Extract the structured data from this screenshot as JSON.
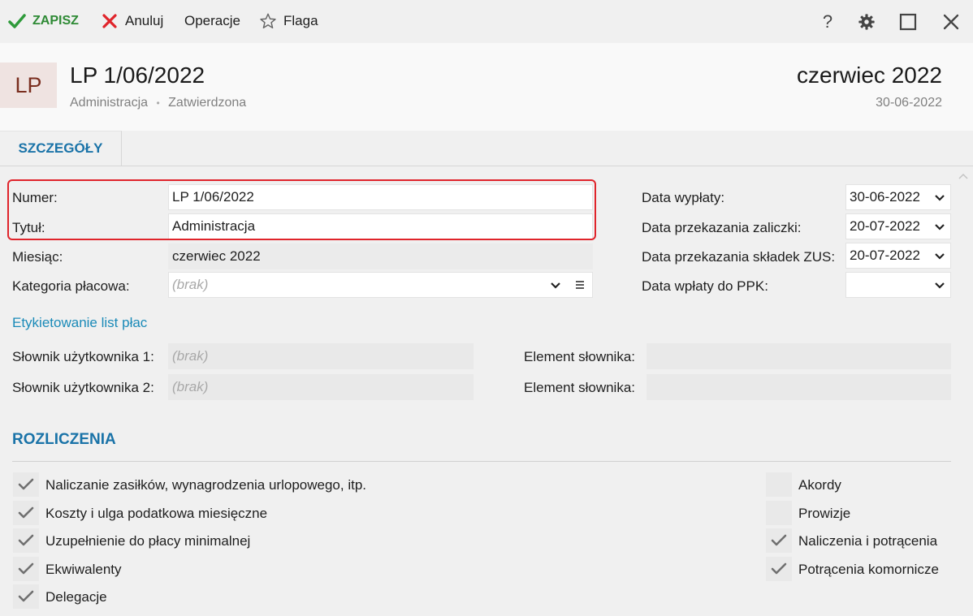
{
  "toolbar": {
    "save_label": "ZAPISZ",
    "cancel_label": "Anuluj",
    "operations_label": "Operacje",
    "flag_label": "Flaga",
    "help_label": "?"
  },
  "header": {
    "avatar_text": "LP",
    "title": "LP 1/06/2022",
    "category": "Administracja",
    "separator": "•",
    "status": "Zatwierdzona",
    "period": "czerwiec 2022",
    "date": "30-06-2022"
  },
  "tabs": [
    {
      "label": "SZCZEGÓŁY",
      "active": true
    }
  ],
  "form": {
    "numer_label": "Numer:",
    "numer_value": "LP 1/06/2022",
    "tytul_label": "Tytuł:",
    "tytul_value": "Administracja",
    "miesiac_label": "Miesiąc:",
    "miesiac_value": "czerwiec 2022",
    "kategoria_label": "Kategoria płacowa:",
    "kategoria_value": "(brak)",
    "data_wyplaty_label": "Data wypłaty:",
    "data_wyplaty_value": "30-06-2022",
    "data_zaliczki_label": "Data przekazania zaliczki:",
    "data_zaliczki_value": "20-07-2022",
    "data_zus_label": "Data przekazania składek ZUS:",
    "data_zus_value": "20-07-2022",
    "data_ppk_label": "Data wpłaty do PPK:",
    "data_ppk_value": ""
  },
  "labels": {
    "link": "Etykietowanie list płac",
    "slownik1_label": "Słownik użytkownika 1:",
    "slownik1_value": "(brak)",
    "slownik2_label": "Słownik użytkownika 2:",
    "slownik2_value": "(brak)",
    "element1_label": "Element słownika:",
    "element2_label": "Element słownika:"
  },
  "rozliczenia": {
    "title": "ROZLICZENIA",
    "left": [
      {
        "label": "Naliczanie zasiłków, wynagrodzenia urlopowego, itp.",
        "checked": true
      },
      {
        "label": "Koszty i ulga podatkowa miesięczne",
        "checked": true
      },
      {
        "label": "Uzupełnienie do płacy minimalnej",
        "checked": true
      },
      {
        "label": "Ekwiwalenty",
        "checked": true
      },
      {
        "label": "Delegacje",
        "checked": true
      }
    ],
    "right": [
      {
        "label": "Akordy",
        "checked": false
      },
      {
        "label": "Prowizje",
        "checked": false
      },
      {
        "label": "Naliczenia i potrącenia",
        "checked": true
      },
      {
        "label": "Potrącenia komornicze",
        "checked": true
      }
    ]
  },
  "colors": {
    "accent": "#1a73a8",
    "save_green": "#2e9a3a",
    "cancel_red": "#e0242b",
    "highlight_red": "#e0242b"
  }
}
